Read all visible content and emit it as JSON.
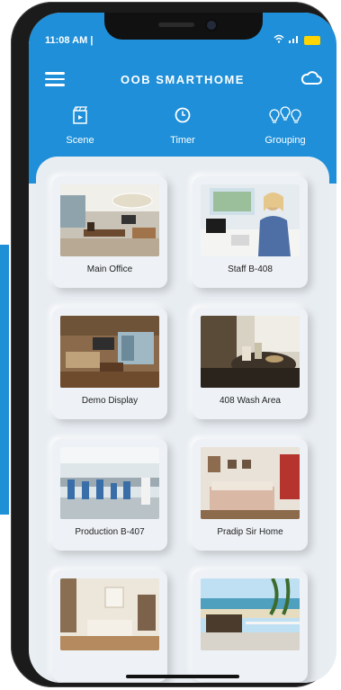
{
  "status": {
    "time": "11:08 AM |"
  },
  "header": {
    "title": "OOB SMARTHOME"
  },
  "tabs": [
    {
      "label": "Scene",
      "icon": "scene-icon"
    },
    {
      "label": "Timer",
      "icon": "clock-icon"
    },
    {
      "label": "Grouping",
      "icon": "bulbs-icon"
    }
  ],
  "rooms": [
    {
      "name": "Main Office"
    },
    {
      "name": "Staff B-408"
    },
    {
      "name": "Demo Display"
    },
    {
      "name": "408 Wash Area"
    },
    {
      "name": "Production B-407"
    },
    {
      "name": "Pradip Sir Home"
    },
    {
      "name": ""
    },
    {
      "name": ""
    }
  ],
  "colors": {
    "accent": "#1e8fd8",
    "background": "#e8edf2"
  }
}
